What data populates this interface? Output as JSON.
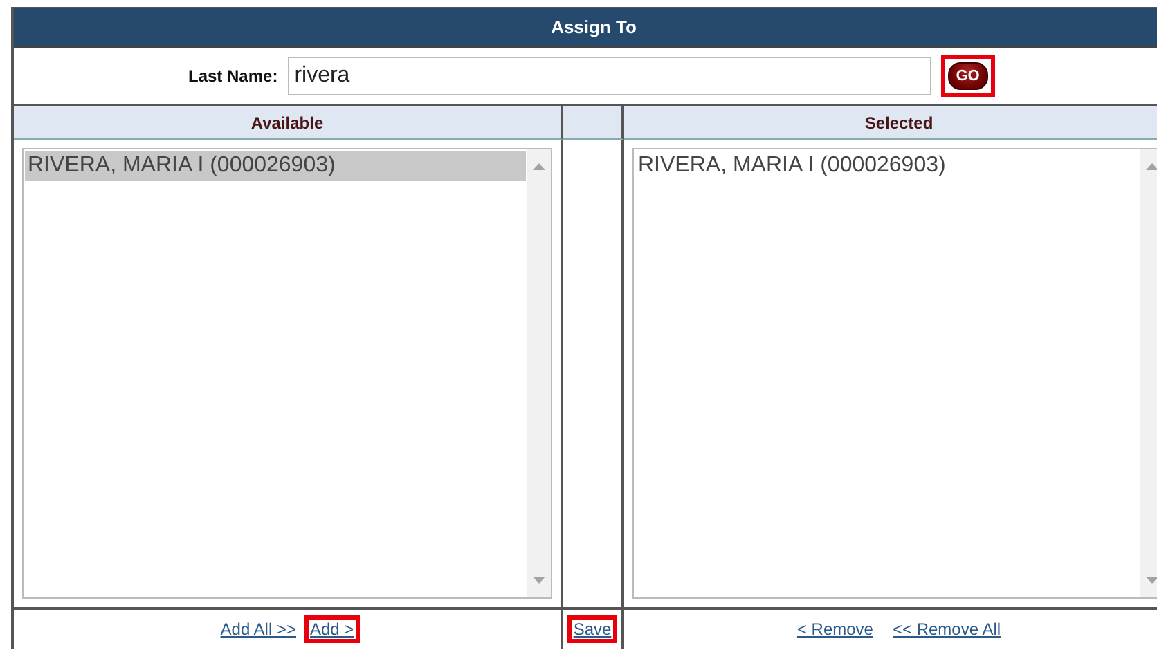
{
  "title": "Assign To",
  "search": {
    "label": "Last Name:",
    "value": "rivera",
    "button": {
      "label": "GO",
      "highlighted": true
    }
  },
  "columns": [
    "Available",
    "Selected"
  ],
  "available": {
    "items": [
      {
        "text": "RIVERA, MARIA I (000026903)",
        "selected": true
      }
    ]
  },
  "selected_list": {
    "items": [
      {
        "text": "RIVERA, MARIA I (000026903)",
        "selected": false
      }
    ]
  },
  "left_links": [
    {
      "label": "Add All >>",
      "highlighted": false
    },
    {
      "label": "Add >",
      "highlighted": true
    }
  ],
  "middle_links": [
    {
      "label": "Save",
      "highlighted": true
    }
  ],
  "right_links": [
    {
      "label": "< Remove",
      "highlighted": false
    },
    {
      "label": "<< Remove All",
      "highlighted": false
    }
  ]
}
